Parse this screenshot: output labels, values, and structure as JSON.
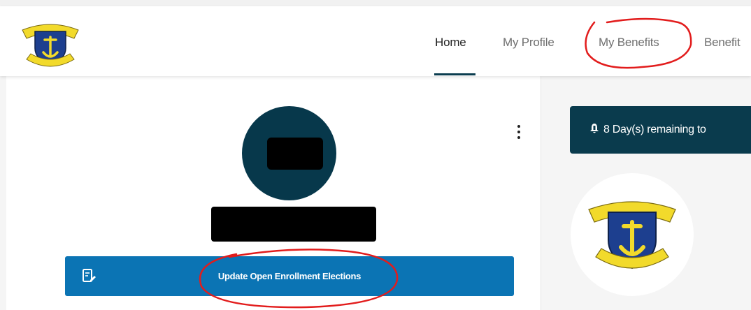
{
  "header": {
    "nav": [
      {
        "label": "Home",
        "active": true
      },
      {
        "label": "My Profile",
        "active": false
      },
      {
        "label": "My Benefits",
        "active": false
      },
      {
        "label": "Benefit",
        "active": false
      }
    ]
  },
  "profile": {
    "enroll_button_label": "Update Open Enrollment Elections",
    "enroll_icon": "document-edit-icon",
    "menu_icon": "kebab-menu-icon"
  },
  "notice": {
    "icon": "bell-icon",
    "text": "8 Day(s) remaining to"
  },
  "colors": {
    "accent_dark": "#0a3b4d",
    "button_blue": "#0b74b4",
    "annotation_red": "#e21c1c"
  }
}
